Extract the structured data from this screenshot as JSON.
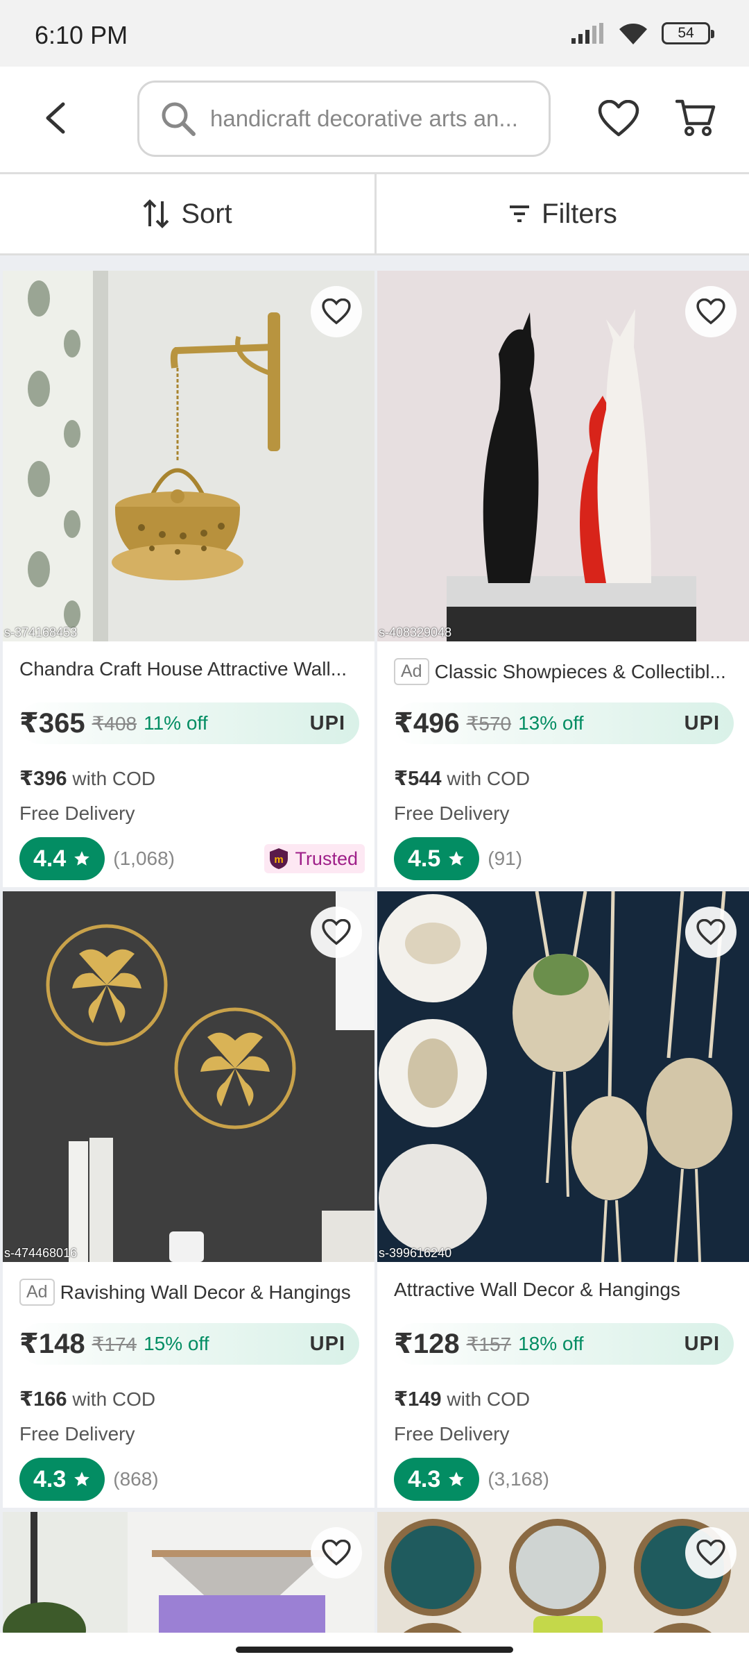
{
  "status_bar": {
    "time": "6:10 PM",
    "battery": "54"
  },
  "header": {
    "search_placeholder": "handicraft decorative arts an...",
    "icons": [
      "back-arrow-icon",
      "search-icon",
      "heart-icon",
      "cart-icon"
    ]
  },
  "toolbar": {
    "sort_label": "Sort",
    "filters_label": "Filters"
  },
  "products": [
    {
      "image_id": "s-374168453",
      "ad": false,
      "title": "Chandra Craft House Attractive Wall...",
      "price": "₹365",
      "old_price": "₹408",
      "discount": "11% off",
      "upi": "UPI",
      "cod_price": "₹396",
      "cod_label": "with COD",
      "delivery": "Free Delivery",
      "rating": "4.4",
      "reviews": "(1,068)",
      "trusted": "Trusted"
    },
    {
      "image_id": "s-408329048",
      "ad": true,
      "ad_label": "Ad",
      "title": "Classic Showpieces & Collectibl...",
      "price": "₹496",
      "old_price": "₹570",
      "discount": "13% off",
      "upi": "UPI",
      "cod_price": "₹544",
      "cod_label": "with COD",
      "delivery": "Free Delivery",
      "rating": "4.5",
      "reviews": "(91)"
    },
    {
      "image_id": "s-474468016",
      "ad": true,
      "ad_label": "Ad",
      "title": "Ravishing Wall Decor & Hangings",
      "price": "₹148",
      "old_price": "₹174",
      "discount": "15% off",
      "upi": "UPI",
      "cod_price": "₹166",
      "cod_label": "with COD",
      "delivery": "Free Delivery",
      "rating": "4.3",
      "reviews": "(868)"
    },
    {
      "image_id": "s-399616240",
      "ad": false,
      "title": "Attractive Wall Decor & Hangings",
      "price": "₹128",
      "old_price": "₹157",
      "discount": "18% off",
      "upi": "UPI",
      "cod_price": "₹149",
      "cod_label": "with COD",
      "delivery": "Free Delivery",
      "rating": "4.3",
      "reviews": "(3,168)"
    }
  ],
  "colors": {
    "rating_green": "#038d63",
    "discount_green": "#038d63",
    "trusted_pink": "#9f2089"
  }
}
